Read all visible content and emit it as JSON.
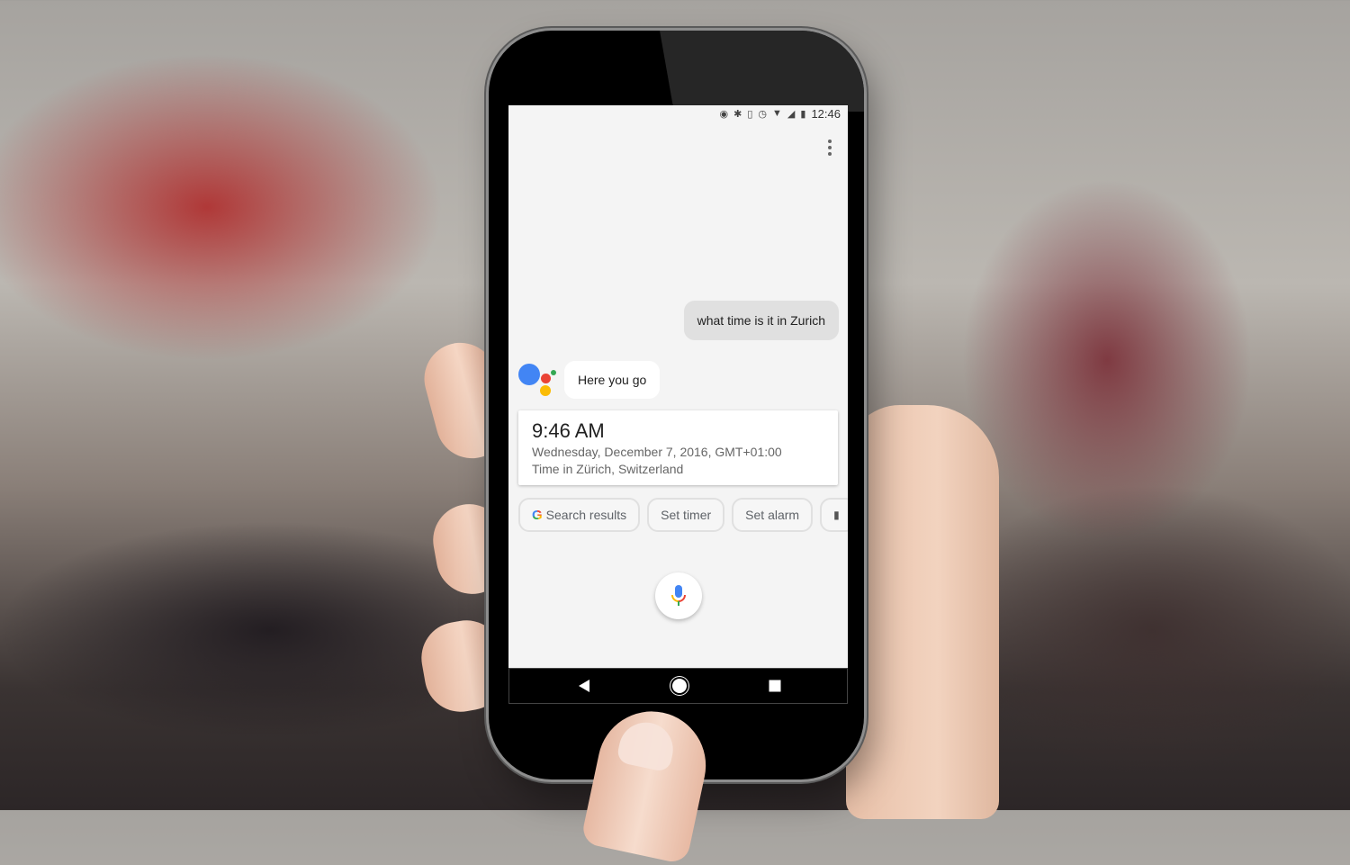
{
  "status_bar": {
    "time": "12:46",
    "icons": [
      "location-icon",
      "bluetooth-icon",
      "vibrate-icon",
      "alarm-icon",
      "wifi-icon",
      "signal-icon",
      "battery-icon"
    ]
  },
  "conversation": {
    "user_query": "what time is it in Zurich",
    "assistant_reply": "Here you go"
  },
  "time_card": {
    "time": "9:46 AM",
    "date": "Wednesday, December 7, 2016, GMT+01:00",
    "location": "Time in Zürich, Switzerland"
  },
  "suggestion_chips": [
    {
      "label": "Search results",
      "icon": "google-g-icon"
    },
    {
      "label": "Set timer"
    },
    {
      "label": "Set alarm"
    },
    {
      "label": "",
      "icon": "feedback-icon"
    }
  ],
  "colors": {
    "google_blue": "#4285f4",
    "google_red": "#ea4335",
    "google_yellow": "#fbbc05",
    "google_green": "#34a853",
    "screen_bg": "#f4f4f4",
    "user_bubble": "#e0e0e0"
  },
  "nav_bar": [
    "back-button",
    "home-button",
    "recents-button"
  ]
}
